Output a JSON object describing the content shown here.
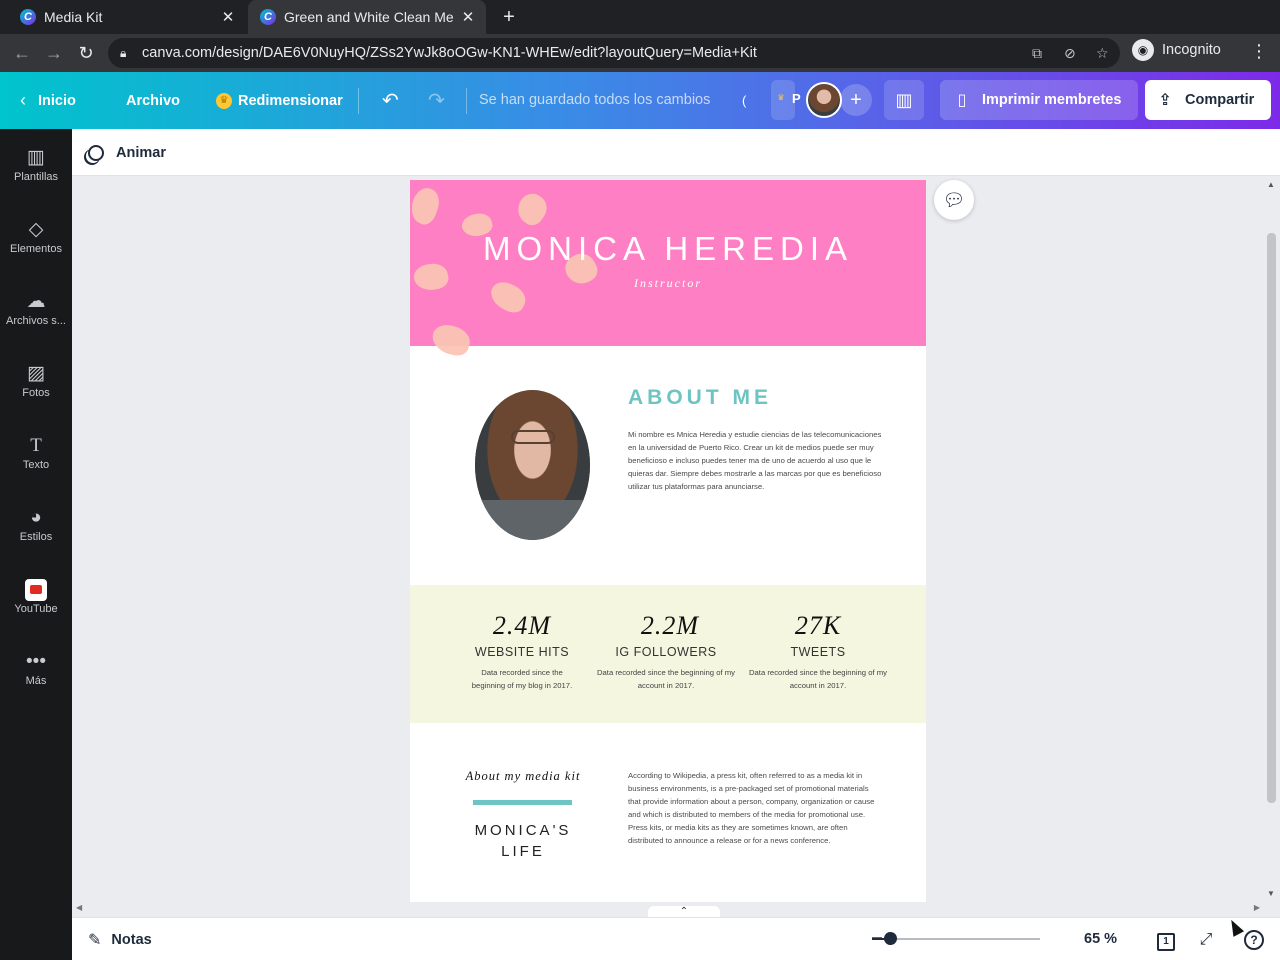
{
  "browser": {
    "tabs": [
      {
        "title": "Media Kit",
        "favicon": "canva-favicon-icon"
      },
      {
        "title": "Green and White Clean Me",
        "favicon": "canva-favicon-icon"
      }
    ],
    "url": "canva.com/design/DAE6V0NuyHQ/ZSs2YwJk8oOGw-KN1-WHEw/edit?layoutQuery=Media+Kit",
    "profile_label": "Incognito"
  },
  "header": {
    "home": "Inicio",
    "file": "Archivo",
    "resize": "Redimensionar",
    "saved_status": "Se han guardado todos los cambios",
    "presence_initial": "P",
    "print_label": "Imprimir membretes",
    "share_label": "Compartir"
  },
  "sidebar": {
    "items": [
      {
        "label": "Plantillas",
        "icon": "templates-icon"
      },
      {
        "label": "Elementos",
        "icon": "elements-icon"
      },
      {
        "label": "Archivos s...",
        "icon": "uploads-icon"
      },
      {
        "label": "Fotos",
        "icon": "photos-icon"
      },
      {
        "label": "Texto",
        "icon": "text-icon"
      },
      {
        "label": "Estilos",
        "icon": "styles-icon"
      },
      {
        "label": "YouTube",
        "icon": "youtube-icon"
      },
      {
        "label": "Más",
        "icon": "more-icon"
      }
    ]
  },
  "toolbar": {
    "animate": "Animar"
  },
  "design": {
    "name": "MONICA HEREDIA",
    "role": "Instructor",
    "about_title": "ABOUT ME",
    "about_text": "Mi nombre es Mnica Heredia y estudie ciencias de las telecomunicaciones en la universidad de Puerto Rico. Crear un kit de medios puede ser muy beneficioso e incluso puedes tener ma de uno de acuerdo al uso que le quieras dar. Siempre debes mostrarle a las marcas por que es beneficioso utilizar tus plataformas para anunciarse.",
    "stats": [
      {
        "value": "2.4M",
        "label": "WEBSITE HITS",
        "note": "Data recorded since the beginning of my blog in 2017."
      },
      {
        "value": "2.2M",
        "label": "IG FOLLOWERS",
        "note": "Data recorded since the beginning of my account in 2017."
      },
      {
        "value": "27K",
        "label": "TWEETS",
        "note": "Data recorded since the beginning of my account in 2017."
      }
    ],
    "kit_subtitle": "About my media kit",
    "kit_title": "MONICA'S LIFE",
    "kit_text": "According to Wikipedia, a press kit, often referred to as a media kit in business environments, is a pre-packaged set of promotional materials that provide information about a person, company, organization or cause and which is distributed to members of the media for promotional use. Press kits, or media kits as they are sometimes known, are often distributed to announce a release or for a news conference."
  },
  "footer": {
    "notes": "Notas",
    "zoom": "65 %",
    "zoom_percent": 65,
    "zoom_slider_fraction": 0.11,
    "page_count": "1"
  },
  "colors": {
    "hero_pink": "#fe7fc4",
    "accent_teal": "#6ec4c3",
    "stats_bg": "#f5f6e0",
    "canva_purple": "#7d2ae8"
  }
}
